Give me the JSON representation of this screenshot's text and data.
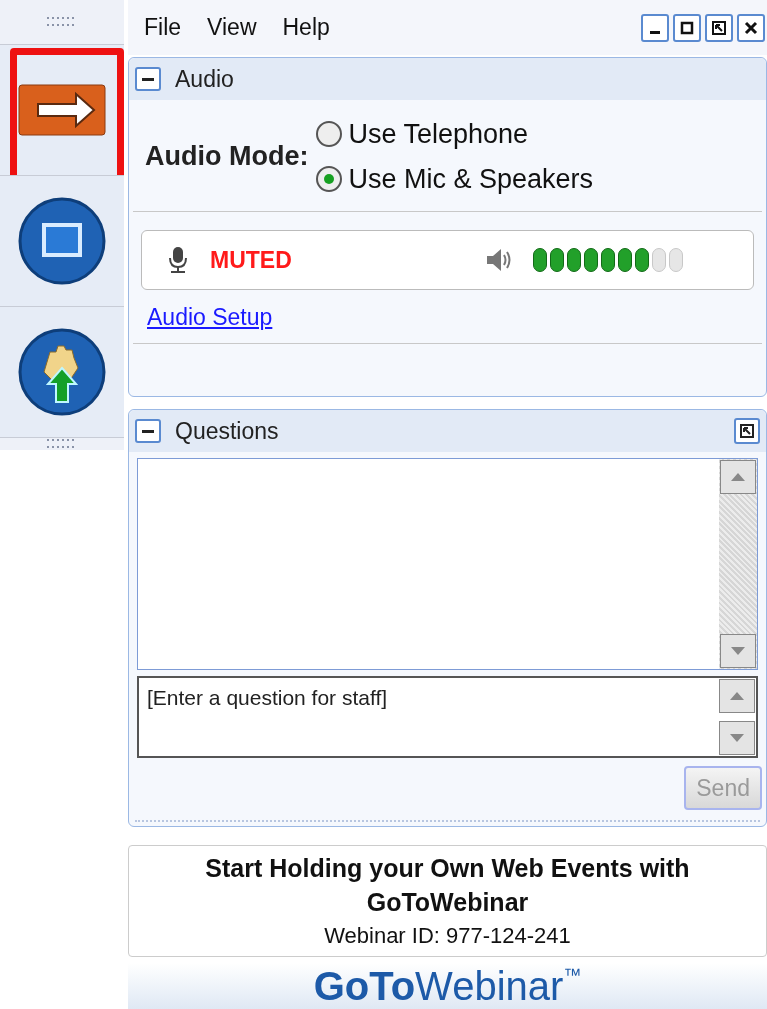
{
  "sidebar": {
    "items": [
      {
        "kind": "arrow",
        "highlighted": true
      },
      {
        "kind": "screen",
        "highlighted": false
      },
      {
        "kind": "hand",
        "highlighted": false
      }
    ]
  },
  "menu": [
    "File",
    "View",
    "Help"
  ],
  "audio": {
    "title": "Audio",
    "mode_label": "Audio Mode:",
    "options": [
      {
        "label": "Use Telephone",
        "selected": false
      },
      {
        "label": "Use Mic & Speakers",
        "selected": true
      }
    ],
    "status": "MUTED",
    "muted": true,
    "level": 0.78,
    "setup_link": "Audio Setup"
  },
  "questions": {
    "title": "Questions",
    "placeholder": "[Enter a question for staff]",
    "send": {
      "label": "Send",
      "disabled": true
    }
  },
  "promo": {
    "headline": "Start Holding your Own Web Events with GoToWebinar",
    "webinar_id": "Webinar ID: 977-124-241"
  },
  "logo": {
    "bold": "GoTo",
    "light": "Webinar",
    "mark": "™"
  }
}
